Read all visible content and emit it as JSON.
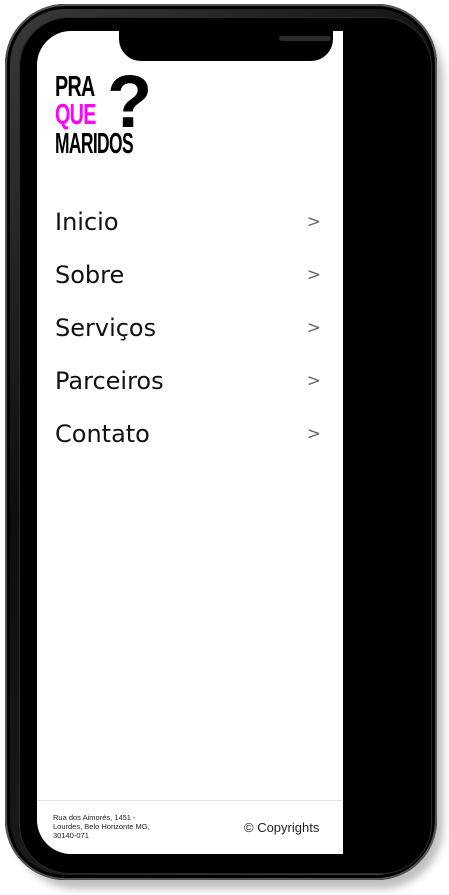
{
  "logo": {
    "line1": "PRA",
    "line2": "QUE",
    "line3": "MARIDOS",
    "mark": "?",
    "accent_color": "#ff00ff"
  },
  "menu": {
    "items": [
      {
        "label": "Inicio",
        "chevron": ">"
      },
      {
        "label": "Sobre",
        "chevron": ">"
      },
      {
        "label": "Serviços",
        "chevron": ">"
      },
      {
        "label": "Parceiros",
        "chevron": ">"
      },
      {
        "label": "Contato",
        "chevron": ">"
      }
    ]
  },
  "footer": {
    "address": "Rua dos Aimorés, 1451 - Lourdes, Belo Horizonte MG, 30140-071",
    "copyright": "© Copyrights"
  }
}
